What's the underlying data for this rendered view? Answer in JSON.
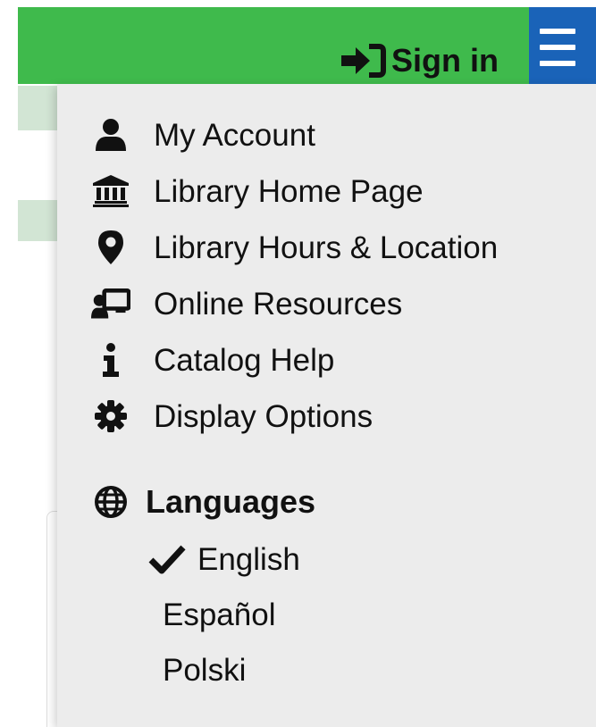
{
  "header": {
    "signin_label": "Sign in",
    "signin_icon": "sign-in-icon",
    "menu_icon": "hamburger-menu-icon",
    "background_color": "#3fba4c",
    "menu_button_color": "#1a63b8"
  },
  "menu": {
    "items": [
      {
        "label": "My Account",
        "icon": "user-icon"
      },
      {
        "label": "Library Home Page",
        "icon": "library-building-icon"
      },
      {
        "label": "Library Hours & Location",
        "icon": "map-marker-icon"
      },
      {
        "label": "Online Resources",
        "icon": "online-resources-icon"
      },
      {
        "label": "Catalog Help",
        "icon": "info-icon"
      },
      {
        "label": "Display Options",
        "icon": "gear-icon"
      }
    ],
    "languages": {
      "label": "Languages",
      "icon": "globe-icon",
      "options": [
        {
          "label": "English",
          "selected": true
        },
        {
          "label": "Español",
          "selected": false
        },
        {
          "label": "Polski",
          "selected": false
        }
      ]
    }
  }
}
